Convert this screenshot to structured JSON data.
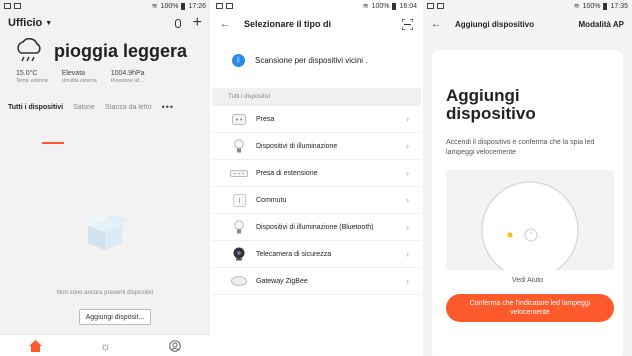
{
  "panel1": {
    "status": {
      "battery": "100%",
      "time": "17:26"
    },
    "home_name": "Ufficio",
    "weather": {
      "condition": "pioggia leggera",
      "stats": [
        {
          "value": "15.0°C",
          "label": "Temp. esterna"
        },
        {
          "value": "Elevata",
          "label": "Umidità esterna"
        },
        {
          "value": "1004.9hPa",
          "label": "Pressione all..."
        }
      ]
    },
    "tabs": [
      {
        "label": "Tutti i dispositivi"
      },
      {
        "label": "Salone"
      },
      {
        "label": "Stanza da letto"
      }
    ],
    "empty_text": "Non sono ancora presenti dispositivi",
    "add_button": "Aggiungi disposit..."
  },
  "panel2": {
    "status": {
      "battery": "100%",
      "time": "16:04"
    },
    "title": "Selezionare il tipo di",
    "scan_label": "Scansione per dispositivi vicini .",
    "section_label": "Tutti i dispositivi",
    "devices": [
      {
        "label": "Presa",
        "icon": "plug-icon"
      },
      {
        "label": "Dispositivi di illuminazione",
        "icon": "bulb-icon"
      },
      {
        "label": "Presa di estensione",
        "icon": "power-strip-icon"
      },
      {
        "label": "Commutu",
        "icon": "switch-icon"
      },
      {
        "label": "Dispositivi di illuminazione (Bluetooth)",
        "icon": "bluetooth-bulb-icon"
      },
      {
        "label": "Telecamera di sicurezza",
        "icon": "camera-icon"
      },
      {
        "label": "Gateway ZigBee",
        "icon": "gateway-icon"
      }
    ]
  },
  "panel3": {
    "status": {
      "battery": "100%",
      "time": "17:35"
    },
    "title": "Aggiungi dispositivo",
    "mode": "Modalità AP",
    "card_title_line1": "Aggiungi",
    "card_title_line2": "dispositivo",
    "description": "Accendi il dispositivo e conferma che la spia led lampeggi velocemente",
    "help": "Vedi Aiuto",
    "confirm_button": "Conferma che l'indicatore led lampeggi velocemente"
  },
  "colors": {
    "accent": "#ff5a2c",
    "bluetooth": "#2a8ae6"
  }
}
